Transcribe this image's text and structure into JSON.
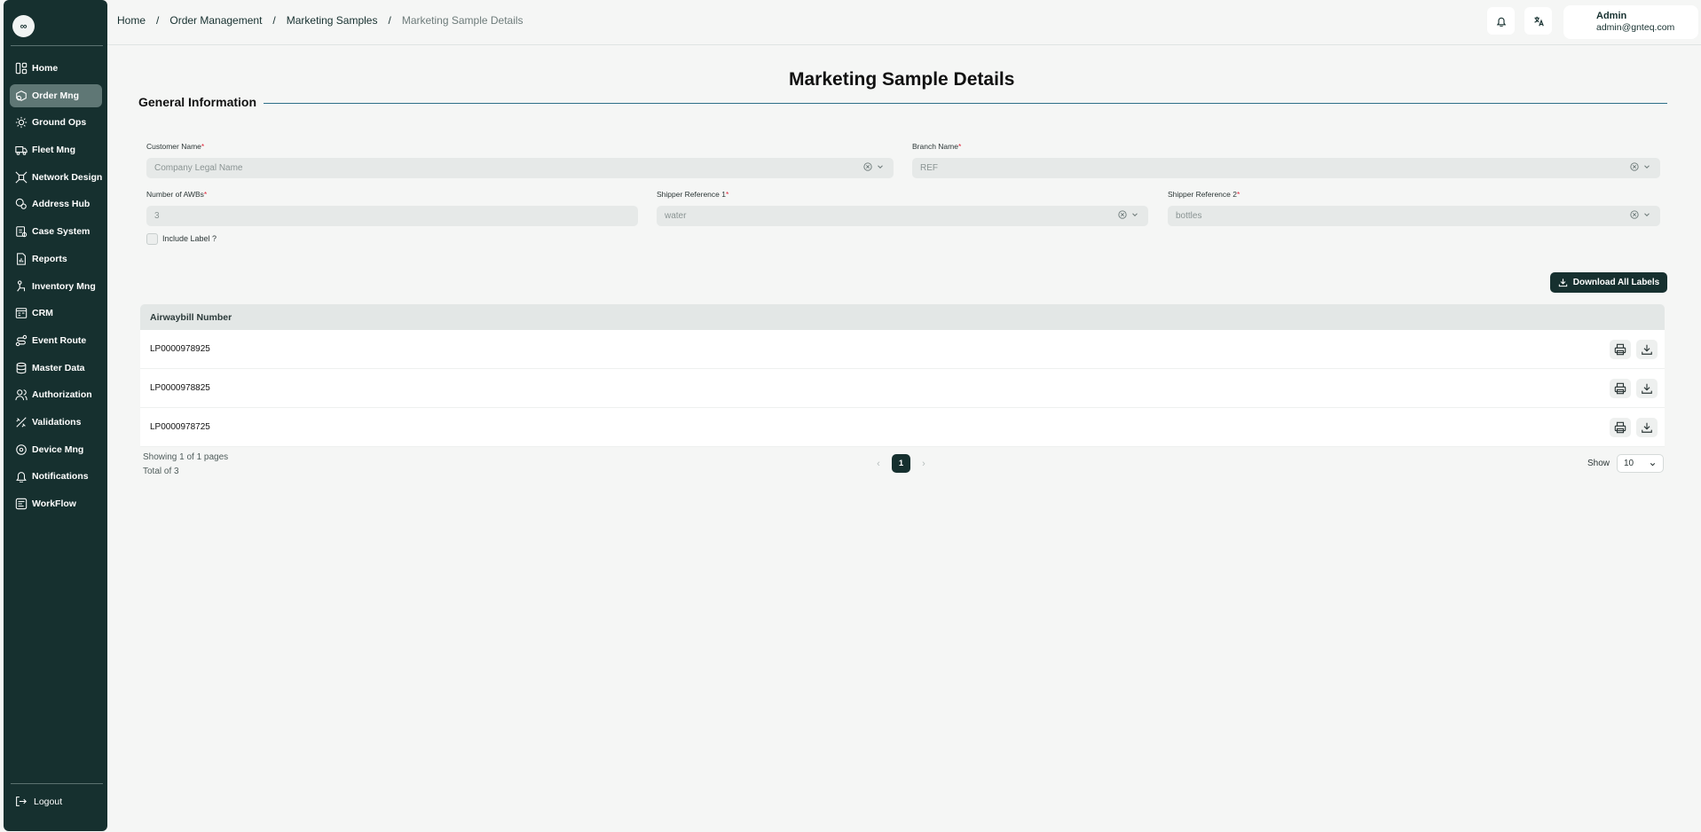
{
  "app": {
    "logo_text": "∞"
  },
  "sidebar": {
    "items": [
      {
        "label": "Home",
        "icon": "home-icon"
      },
      {
        "label": "Order Mng",
        "icon": "order-icon",
        "active": true
      },
      {
        "label": "Ground Ops",
        "icon": "ground-ops-icon"
      },
      {
        "label": "Fleet Mng",
        "icon": "truck-icon"
      },
      {
        "label": "Network Design",
        "icon": "network-icon"
      },
      {
        "label": "Address Hub",
        "icon": "address-icon"
      },
      {
        "label": "Case System",
        "icon": "case-icon"
      },
      {
        "label": "Reports",
        "icon": "reports-icon"
      },
      {
        "label": "Inventory Mng",
        "icon": "inventory-icon"
      },
      {
        "label": "CRM",
        "icon": "crm-icon"
      },
      {
        "label": "Event Route",
        "icon": "route-icon"
      },
      {
        "label": "Master Data",
        "icon": "database-icon"
      },
      {
        "label": "Authorization",
        "icon": "users-icon"
      },
      {
        "label": "Validations",
        "icon": "validations-icon"
      },
      {
        "label": "Device Mng",
        "icon": "device-icon"
      },
      {
        "label": "Notifications",
        "icon": "bell-icon"
      },
      {
        "label": "WorkFlow",
        "icon": "workflow-icon"
      }
    ],
    "logout_label": "Logout"
  },
  "header": {
    "breadcrumb": [
      "Home",
      "Order Management",
      "Marketing Samples",
      "Marketing Sample Details"
    ],
    "breadcrumb_sep": "/",
    "user": {
      "name": "Admin",
      "email": "admin@gnteq.com"
    }
  },
  "page": {
    "title": "Marketing Sample Details",
    "section_title": "General Information"
  },
  "form": {
    "customer_name": {
      "label": "Customer Name",
      "placeholder": "Company Legal Name"
    },
    "branch_name": {
      "label": "Branch Name",
      "value": "REF"
    },
    "num_awbs": {
      "label": "Number of AWBs",
      "value": "3"
    },
    "shipper_ref_1": {
      "label": "Shipper Reference 1",
      "value": "water"
    },
    "shipper_ref_2": {
      "label": "Shipper Reference 2",
      "value": "bottles"
    },
    "required_mark": "*",
    "include_label": {
      "label": "Include Label ?",
      "checked": false
    }
  },
  "actions": {
    "download_all": "Download All Labels"
  },
  "table": {
    "header": "Airwaybill Number",
    "rows": [
      "LP0000978925",
      "LP0000978825",
      "LP0000978725"
    ]
  },
  "pagination": {
    "showing": "Showing 1 of 1 pages",
    "total": "Total of 3",
    "current_page": "1",
    "prev": "‹",
    "next": "›",
    "show_label": "Show",
    "page_size": "10"
  }
}
